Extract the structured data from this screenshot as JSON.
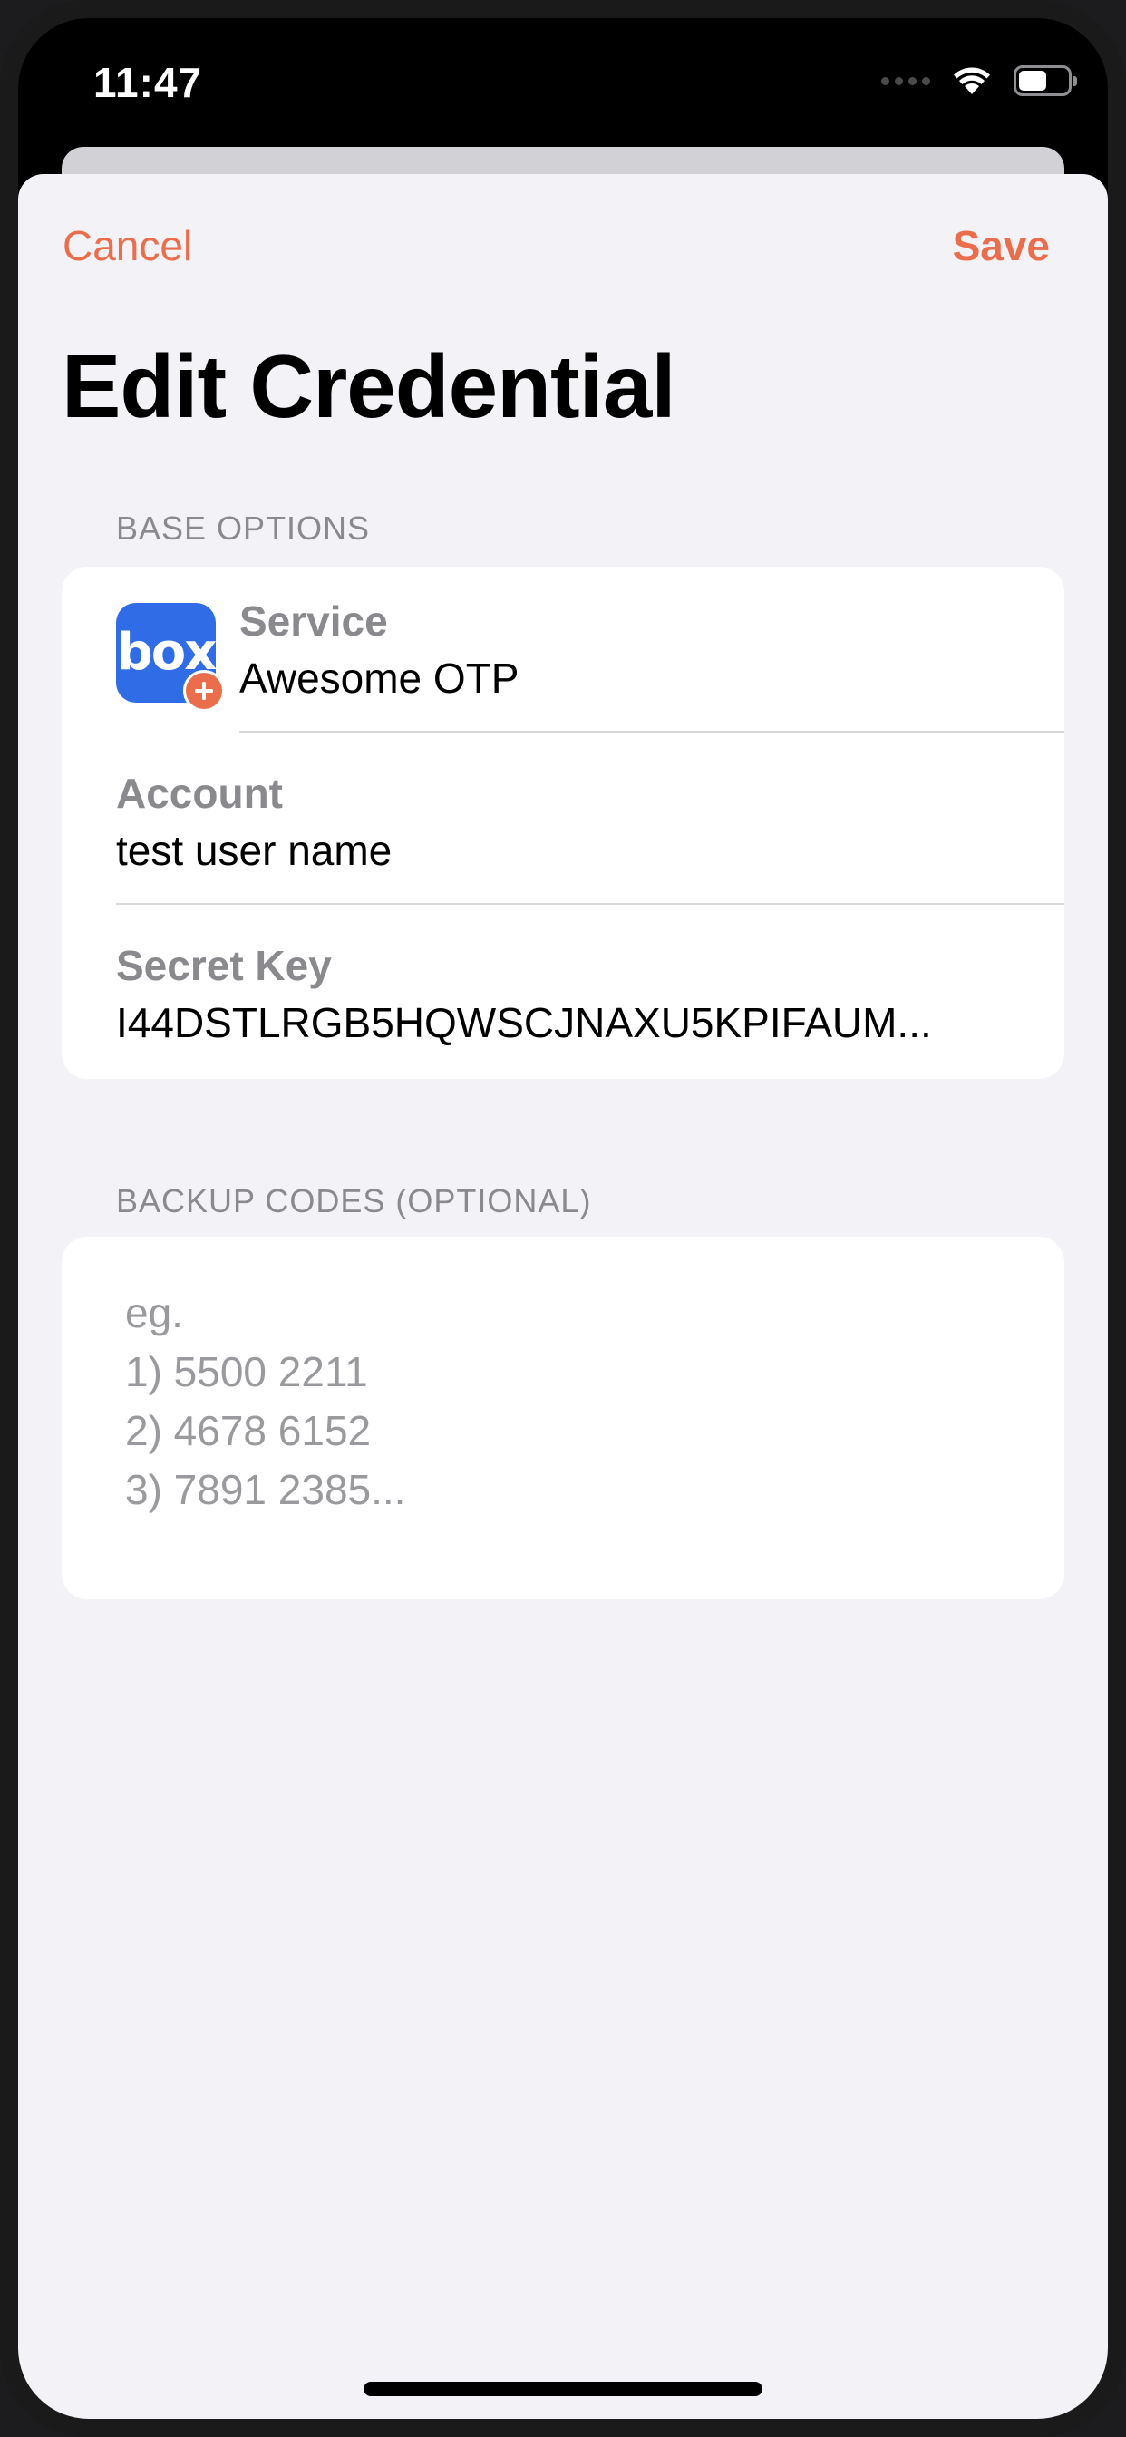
{
  "status_bar": {
    "time": "11:47",
    "icons": [
      "cellular-signal-icon",
      "wifi-icon",
      "battery-icon"
    ]
  },
  "nav": {
    "cancel_label": "Cancel",
    "save_label": "Save"
  },
  "title": "Edit Credential",
  "base_options": {
    "header": "BASE OPTIONS",
    "service": {
      "label": "Service",
      "value": "Awesome OTP",
      "icon_text": "box",
      "icon_color": "#2f6ce6",
      "badge_icon": "plus-icon"
    },
    "account": {
      "label": "Account",
      "value": "test user name"
    },
    "secret_key": {
      "label": "Secret Key",
      "value": "I44DSTLRGB5HQWSCJNAXU5KPIFAUM..."
    }
  },
  "backup_codes": {
    "header": "BACKUP CODES (OPTIONAL)",
    "value": "",
    "placeholder": "eg.\n1) 5500 2211\n2) 4678 6152\n3) 7891 2385..."
  },
  "colors": {
    "accent": "#ea6e4c",
    "background": "#f2f2f7",
    "card": "#ffffff",
    "secondary_text": "#8a8a8e"
  }
}
